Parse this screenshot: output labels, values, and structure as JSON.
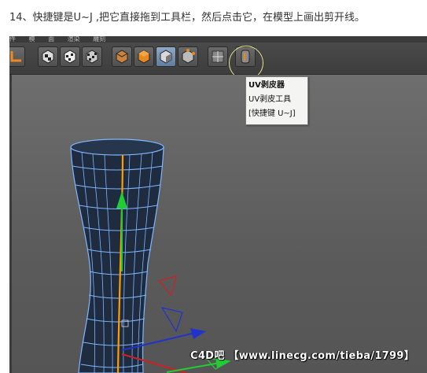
{
  "caption": "14、快捷键是U~J ,把它直接拖到工具栏，然后点击它，在模型上画出剪开线。",
  "menubar": [
    "件",
    "模",
    "面",
    "渲染",
    "雕刻"
  ],
  "toolbar": {
    "buttons": [
      {
        "name": "axis-tool-icon",
        "active": false
      },
      {
        "name": "checker-cube-icon",
        "active": false
      },
      {
        "name": "checker-sphere-icon",
        "active": false
      },
      {
        "name": "checker-flag-icon",
        "active": false
      },
      {
        "name": "cube-wire-icon",
        "active": false
      },
      {
        "name": "cube-orange-icon",
        "active": false
      },
      {
        "name": "cube-solid-icon",
        "active": true
      },
      {
        "name": "cube-points-icon",
        "active": false
      },
      {
        "name": "uv-tiles-icon",
        "active": false
      },
      {
        "name": "uv-peeler-icon",
        "active": false
      }
    ]
  },
  "tooltip": {
    "title": "UV剥皮器",
    "description": "UV剥皮工具",
    "shortcut": "[快捷键 U~J]"
  },
  "watermark": "C4D吧 【www.linecg.com/tieba/1799】",
  "colors": {
    "viewport": "#5d5d5d",
    "mesh_wire": "#7fb6ff",
    "mesh_fill": "#1b2a40",
    "axis_y": "#22cc33",
    "seam_line": "#ff9d00",
    "axis_x": "#cc2222",
    "axis_z": "#2233cc"
  }
}
